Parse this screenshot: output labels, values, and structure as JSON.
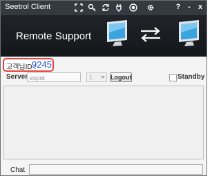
{
  "window": {
    "title": "Seetrol Client"
  },
  "toolbar": {
    "icons": [
      "fullscreen-icon",
      "search-key-icon",
      "refresh-icon",
      "plug-icon",
      "record-icon",
      "gear-icon"
    ],
    "help_label": "?",
    "minimize_label": "-",
    "close_label": "x"
  },
  "banner": {
    "title": "Remote Support"
  },
  "customer": {
    "label": "고객님ID :",
    "id": "9245"
  },
  "server": {
    "label": "Server",
    "value": "espot",
    "port": "1",
    "logout_label": "Logout",
    "standby_label": "Standby",
    "standby_checked": false
  },
  "chat": {
    "label": "Chat",
    "value": ""
  },
  "colors": {
    "titlebar": "#333a40",
    "banner": "#1b1f23",
    "id_highlight": "#e8413c",
    "id_text": "#1e4fd6",
    "monitor_screen": "#3aa3e0"
  }
}
